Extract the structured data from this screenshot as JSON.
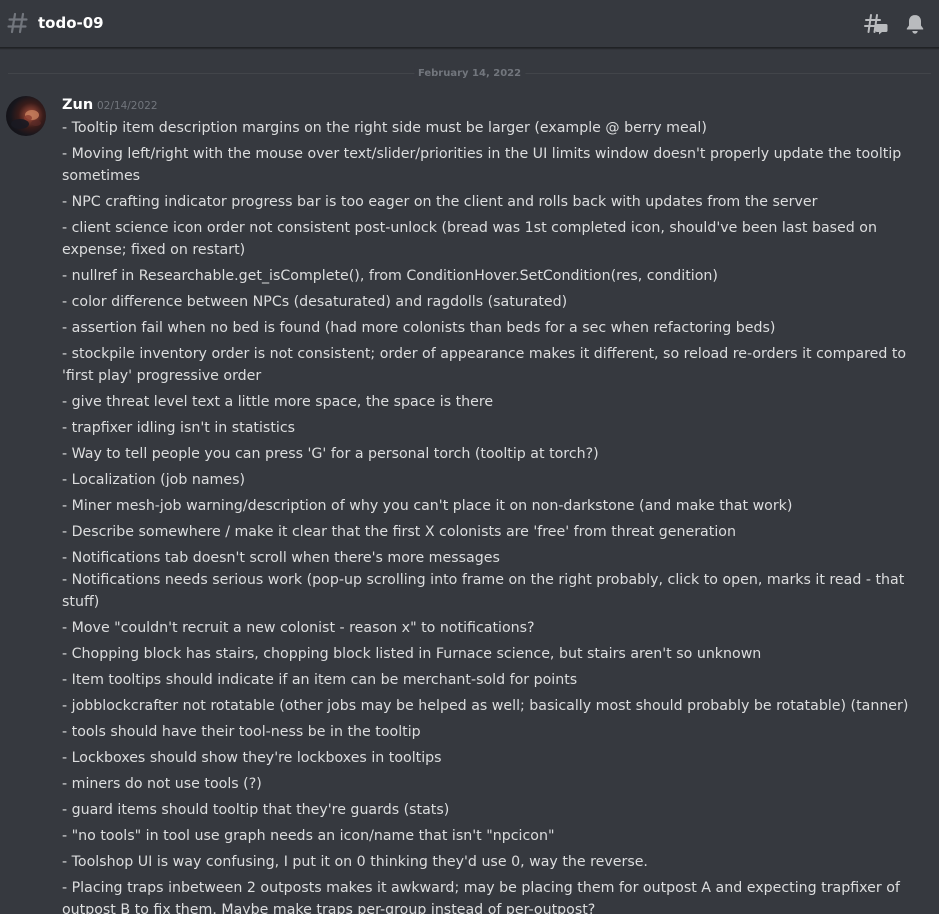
{
  "header": {
    "channel_name": "todo-09"
  },
  "divider": {
    "date": "February 14, 2022"
  },
  "message": {
    "author": "Zun",
    "timestamp": "02/14/2022",
    "lines": [
      "- Tooltip item description margins on the right side must be larger (example @ berry meal)",
      "- Moving left/right with the mouse over text/slider/priorities in the UI limits window doesn't properly update the tooltip sometimes",
      "- NPC crafting indicator progress bar is too eager on the client and rolls back with updates from the server",
      "- client science icon order not consistent post-unlock (bread was 1st completed icon, should've been last based on expense; fixed on restart)",
      "- nullref in Researchable.get_isComplete(), from ConditionHover.SetCondition(res, condition)",
      "- color difference between NPCs (desaturated) and ragdolls (saturated)",
      "- assertion fail when no bed is found (had more colonists than beds for a sec when refactoring beds)",
      "- stockpile inventory order is not consistent; order of appearance makes it different, so reload re-orders it compared to 'first play' progressive order",
      "- give threat level text a little more space, the space is there",
      "- trapfixer idling isn't in statistics",
      "- Way to tell people you can press 'G' for a personal torch (tooltip at torch?)",
      "- Localization (job names)",
      "- Miner mesh-job warning/description of why you can't place it on non-darkstone (and make that work)",
      "- Describe somewhere / make it clear that the first X colonists are 'free' from threat generation",
      "- Notifications tab doesn't scroll when there's more messages",
      "- Notifications needs serious work (pop-up scrolling into frame on the right probably, click to open, marks it read - that stuff)",
      "- Move \"couldn't recruit a new colonist - reason x\" to notifications?",
      "- Chopping block has stairs, chopping block listed in Furnace science, but stairs aren't so unknown",
      "- Item tooltips should indicate if an item can be merchant-sold for points",
      "- jobblockcrafter not rotatable (other jobs may be helped as well; basically most should probably be rotatable) (tanner)",
      "- tools should have their tool-ness be in the tooltip",
      "- Lockboxes should show they're lockboxes in tooltips",
      "- miners do not use tools (?)",
      "- guard items should tooltip that they're guards (stats)",
      "- \"no tools\" in tool use graph needs an icon/name that isn't \"npcicon\"",
      "- Toolshop UI is way confusing, I put it on 0 thinking they'd use 0, way the reverse.",
      "- Placing traps inbetween 2 outposts makes it awkward; may be placing them for outpost A and expecting trapfixer of outpost B to fix them. Maybe make traps per-group instead of per-outpost?"
    ]
  },
  "icons": {
    "channel": "hash-icon",
    "threads": "threads-icon",
    "notifications": "bell-icon"
  },
  "colors": {
    "background": "#36393f",
    "text": "#dcddde",
    "muted": "#72767d",
    "header_text": "#ffffff"
  }
}
